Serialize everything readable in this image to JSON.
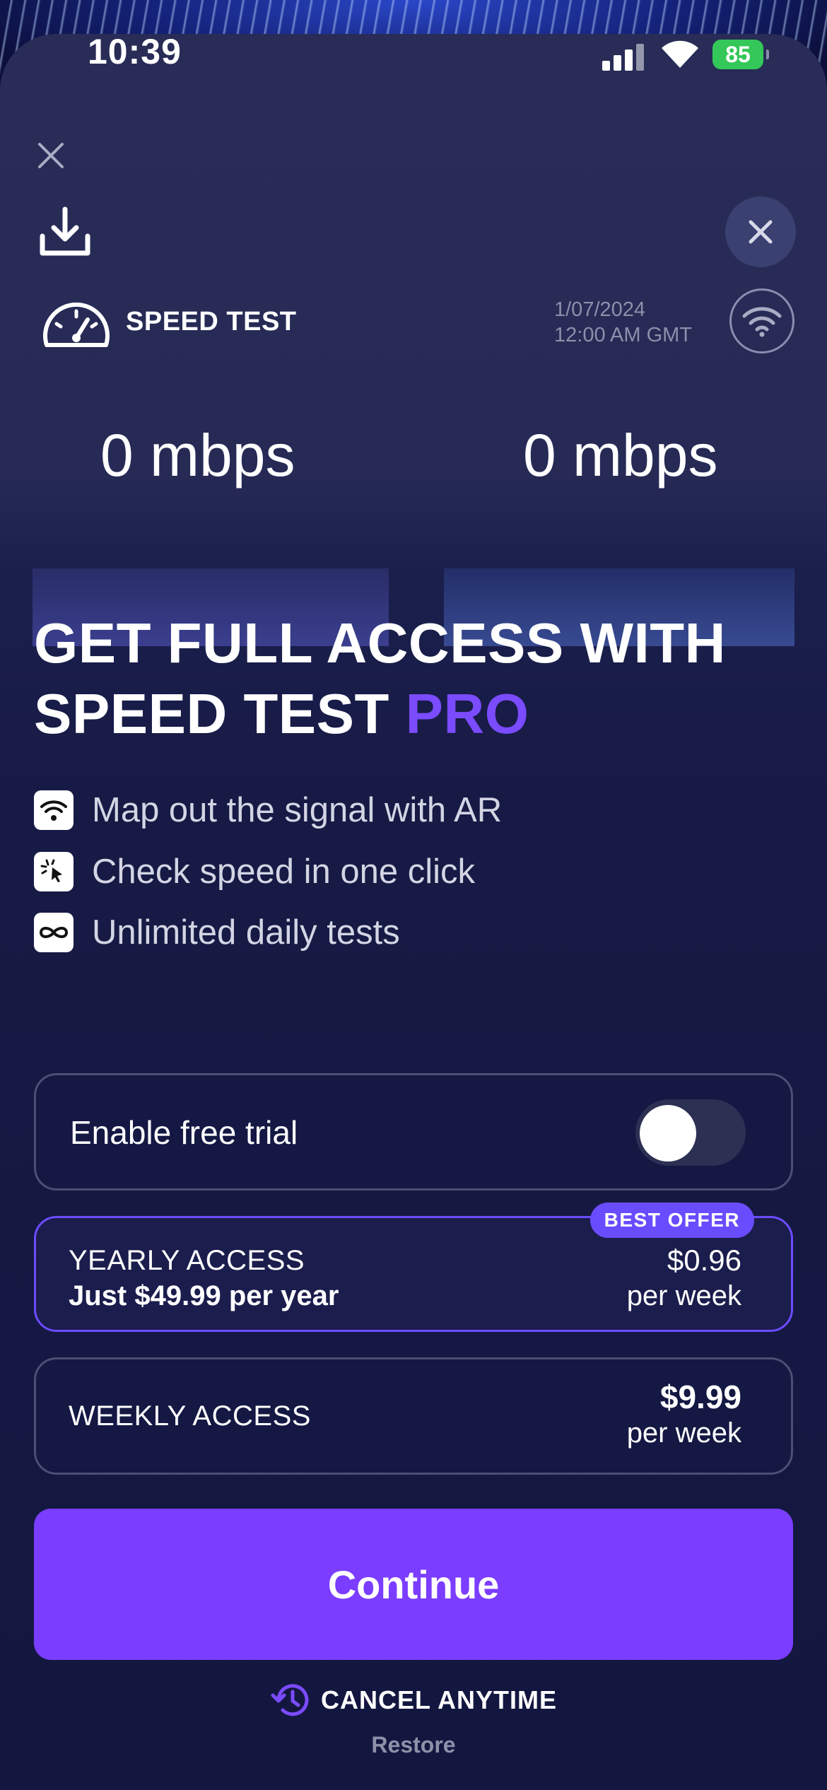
{
  "status_bar": {
    "time": "10:39",
    "battery": "85"
  },
  "header": {
    "app_title": "SPEED TEST",
    "date": "1/07/2024",
    "time": "12:00 AM GMT"
  },
  "speeds": {
    "download": "0 mbps",
    "upload": "0 mbps"
  },
  "headline": {
    "line1": "GET FULL ACCESS WITH",
    "line2_prefix": "SPEED TEST ",
    "line2_accent": "PRO"
  },
  "features": [
    {
      "icon": "wifi-icon",
      "label": "Map out the signal with AR"
    },
    {
      "icon": "tap-click-icon",
      "label": "Check speed in one click"
    },
    {
      "icon": "infinity-icon",
      "label": "Unlimited daily tests"
    }
  ],
  "trial": {
    "label": "Enable free trial",
    "enabled": false
  },
  "plans": {
    "yearly": {
      "badge": "BEST OFFER",
      "name": "YEARLY ACCESS",
      "subtitle": "Just $49.99 per year",
      "price": "$0.96",
      "period": "per week"
    },
    "weekly": {
      "name": "WEEKLY ACCESS",
      "price": "$9.99",
      "period": "per week"
    }
  },
  "actions": {
    "continue": "Continue",
    "cancel_anytime": "CANCEL ANYTIME",
    "restore": "Restore"
  },
  "colors": {
    "accent": "#7b3dff",
    "pro_text": "#7b4bff",
    "background": "#161a44",
    "battery": "#34c759"
  }
}
